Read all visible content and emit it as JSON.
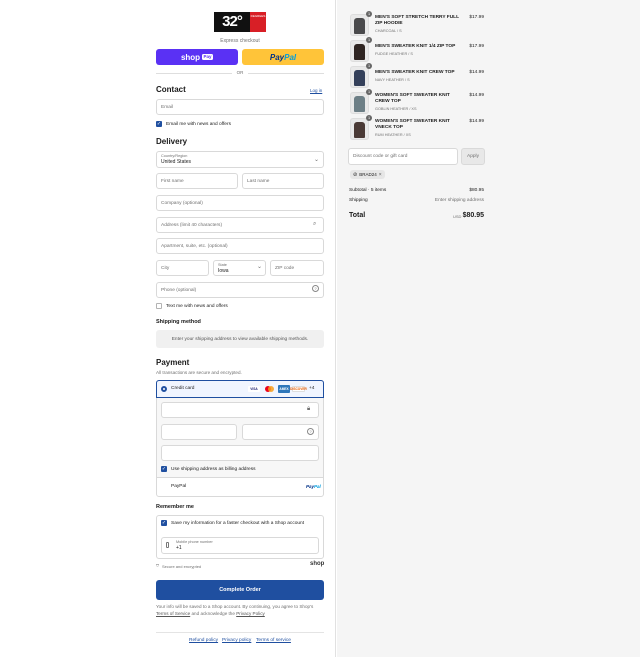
{
  "brand": {
    "logo_main": "32°",
    "logo_side": "DEGREES"
  },
  "express": {
    "label": "Express checkout",
    "shop_label": "shop",
    "shop_pay": "Pay",
    "paypal_a": "Pay",
    "paypal_b": "Pal",
    "or": "OR"
  },
  "contact": {
    "heading": "Contact",
    "login": "Log in",
    "email_placeholder": "Email",
    "news_label": "Email me with news and offers"
  },
  "delivery": {
    "heading": "Delivery",
    "country_label": "Country/Region",
    "country_value": "United States",
    "first_name": "First name",
    "last_name": "Last name",
    "company": "Company (optional)",
    "address": "Address (limit 40 characters)",
    "apartment": "Apartment, suite, etc. (optional)",
    "city": "City",
    "state_label": "State",
    "state_value": "Iowa",
    "zip": "ZIP code",
    "phone": "Phone (optional)",
    "text_label": "Text me with news and offers"
  },
  "shipping": {
    "heading": "Shipping method",
    "message": "Enter your shipping address to view available shipping methods."
  },
  "payment": {
    "heading": "Payment",
    "subtitle": "All transactions are secure and encrypted.",
    "credit_card": "Credit card",
    "more_brands": "+4",
    "brands": [
      "VISA",
      "MC",
      "AMEX",
      "DISCOVER"
    ],
    "billing_label": "Use shipping address as billing address",
    "paypal": "PayPal"
  },
  "remember": {
    "heading": "Remember me",
    "save_label": "Save my information for a faster checkout with a Shop account",
    "mobile_label": "Mobile phone number",
    "mobile_value": "+1",
    "secure": "Secure and encrypted",
    "shop": "shop"
  },
  "complete_label": "Complete Order",
  "disclaimer": {
    "text1": "Your info will be saved to a Shop account. By continuing, you agree to Shop's",
    "tos": "Terms of Service",
    "text2": "and acknowledge the",
    "privacy": "Privacy Policy"
  },
  "footer": {
    "refund": "Refund policy",
    "privacy": "Privacy policy",
    "terms": "Terms of service"
  },
  "cart": {
    "items": [
      {
        "qty": "1",
        "name": "MEN'S SOFT STRETCH TERRY FULL ZIP HOODIE",
        "variant": "CHARCOAL / S",
        "price": "$17.99"
      },
      {
        "qty": "1",
        "name": "MEN'S SWEATER KNIT 1/4 ZIP TOP",
        "variant": "FUDGE HEATHER / S",
        "price": "$17.99"
      },
      {
        "qty": "1",
        "name": "MEN'S SWEATER KNIT CREW TOP",
        "variant": "NAVY HEATHER / S",
        "price": "$14.99"
      },
      {
        "qty": "1",
        "name": "WOMEN'S SOFT SWEATER KNIT CREW TOP",
        "variant": "GOBLIN HEATHER / XS",
        "price": "$14.99"
      },
      {
        "qty": "1",
        "name": "WOMEN'S SOFT SWEATER KNIT VNECK TOP",
        "variant": "RUM HEATHER / XS",
        "price": "$14.99"
      }
    ],
    "discount_placeholder": "Discount code or gift card",
    "apply": "Apply",
    "code": "BRAD24",
    "subtotal_label": "Subtotal · 5 items",
    "subtotal_value": "$80.95",
    "shipping_label": "Shipping",
    "shipping_value": "Enter shipping address",
    "total_label": "Total",
    "currency": "USD",
    "total_value": "$80.95"
  },
  "colors": {
    "accent": "#1f4fa0",
    "shop_purple": "#5a31f4",
    "paypal_yellow": "#ffc439"
  }
}
